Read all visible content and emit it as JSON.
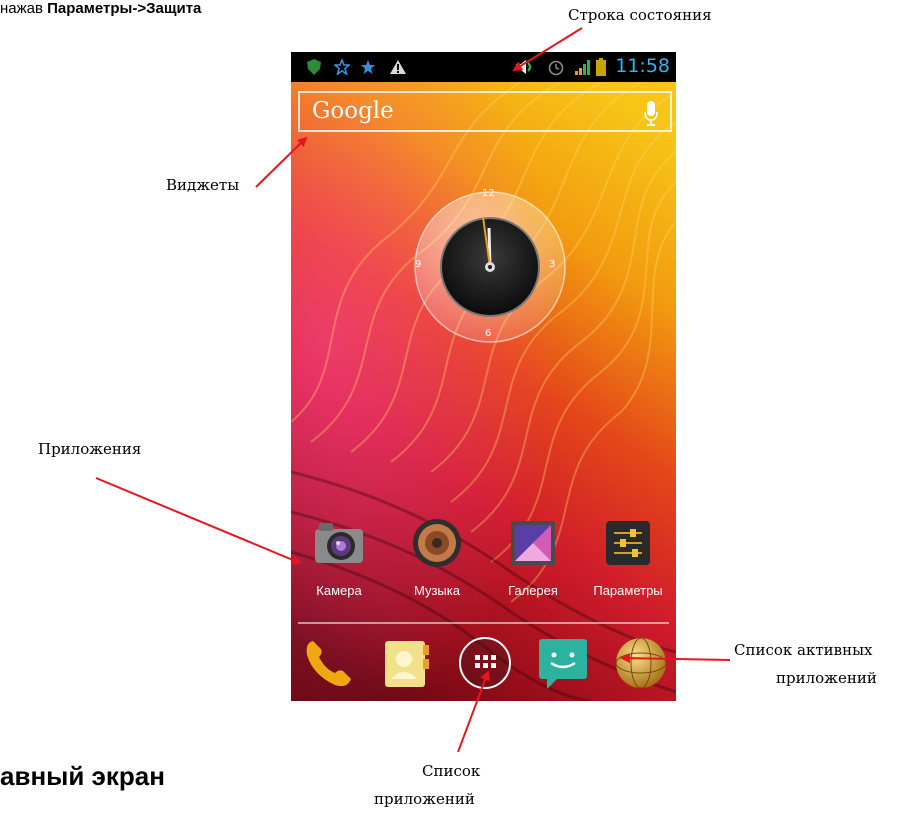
{
  "document": {
    "intro_prefix": "нажав ",
    "intro_bold": "Параметры->Защита",
    "section_heading": "авный экран"
  },
  "callouts": {
    "status_bar": "Строка состояния",
    "widgets": "Виджеты",
    "apps": "Приложения",
    "active_apps_line1": "Список активных",
    "active_apps_line2": "приложений",
    "app_list_line1": "Список",
    "app_list_line2": "приложений"
  },
  "phone": {
    "status_time": "11:58",
    "search_label": "Google",
    "clock_numbers": {
      "n12": "12",
      "n3": "3",
      "n6": "6",
      "n9": "9"
    },
    "apps": [
      {
        "label": "Камера",
        "icon": "camera-icon"
      },
      {
        "label": "Музыка",
        "icon": "music-speaker-icon"
      },
      {
        "label": "Галерея",
        "icon": "gallery-icon"
      },
      {
        "label": "Параметры",
        "icon": "settings-sliders-icon"
      }
    ],
    "dock": [
      {
        "icon": "phone-icon"
      },
      {
        "icon": "contacts-icon"
      },
      {
        "icon": "app-drawer-icon"
      },
      {
        "icon": "messaging-icon"
      },
      {
        "icon": "browser-globe-icon"
      }
    ]
  },
  "colors": {
    "status_time": "#39b4e6",
    "callout_arrow": "#e8161c",
    "wallpaper_top": "#f2a20f",
    "wallpaper_bottom": "#7e0a16"
  }
}
